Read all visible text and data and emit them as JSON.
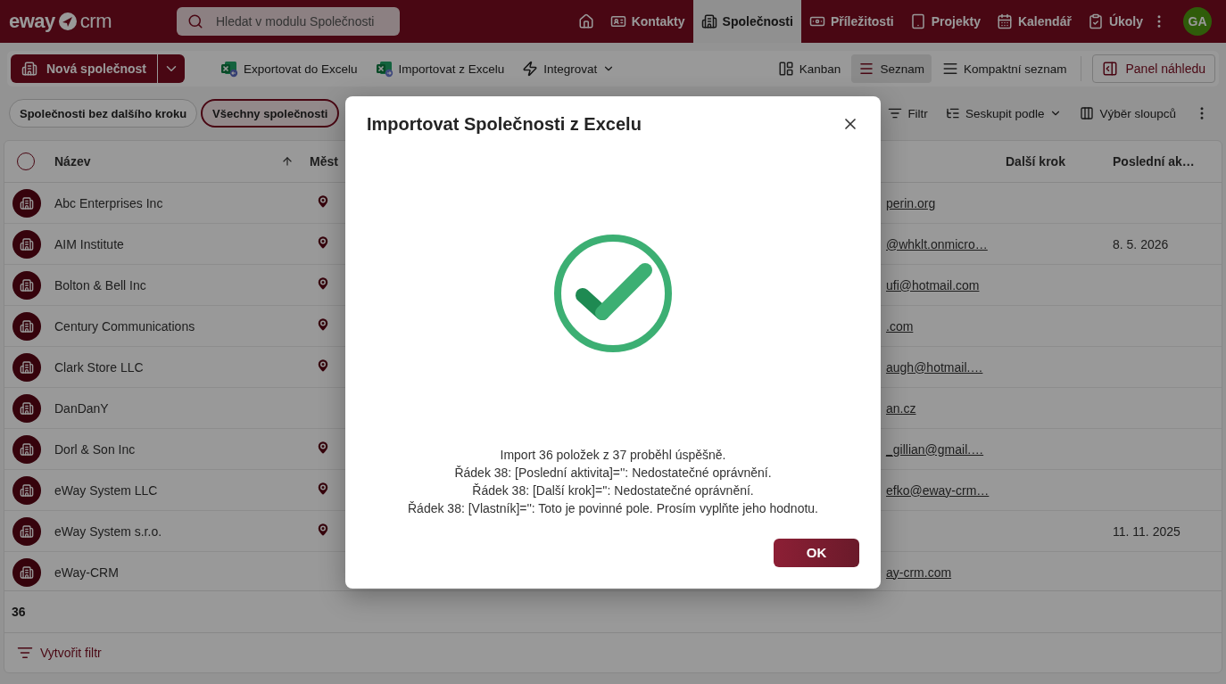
{
  "app": {
    "logo_left": "eway",
    "logo_right": "crm"
  },
  "search": {
    "placeholder": "Hledat v modulu Společnosti"
  },
  "nav": [
    {
      "kind": "home",
      "selected": false
    },
    {
      "kind": "contacts",
      "label": "Kontakty",
      "selected": false
    },
    {
      "kind": "companies",
      "label": "Společnosti",
      "selected": true
    },
    {
      "kind": "deals",
      "label": "Příležitosti",
      "selected": false
    },
    {
      "kind": "projects",
      "label": "Projekty",
      "selected": false
    },
    {
      "kind": "calendar",
      "label": "Kalendář",
      "selected": false
    },
    {
      "kind": "tasks",
      "label": "Úkoly",
      "selected": false
    }
  ],
  "avatar": {
    "initials": "GA"
  },
  "toolbar": {
    "new_button": "Nová společnost",
    "actions": [
      {
        "kind": "export",
        "label": "Exportovat do Excelu"
      },
      {
        "kind": "import",
        "label": "Importovat z Excelu"
      },
      {
        "kind": "integrate",
        "label": "Integrovat"
      }
    ],
    "views": [
      {
        "kind": "kanban",
        "label": "Kanban",
        "selected": false
      },
      {
        "kind": "list",
        "label": "Seznam",
        "selected": true
      },
      {
        "kind": "compact",
        "label": "Kompaktní seznam",
        "selected": false
      }
    ],
    "preview_button": "Panel náhledu"
  },
  "filters": [
    {
      "label": "Společnosti bez dalšího kroku",
      "selected": false
    },
    {
      "label": "Všechny společnosti",
      "selected": true
    }
  ],
  "filter_actions": [
    {
      "kind": "filter",
      "label": "Filtr"
    },
    {
      "kind": "group",
      "label": "Seskupit podle"
    },
    {
      "kind": "columns",
      "label": "Výběr sloupců"
    }
  ],
  "table": {
    "select_all": {
      "checked": false
    },
    "columns": [
      {
        "label": "Název",
        "sorted": true
      },
      {
        "label": "Měst",
        "sorted": false
      },
      {
        "label": "Další krok",
        "sorted": false
      },
      {
        "label": "Poslední ak…",
        "sorted": false
      }
    ],
    "rows": [
      {
        "name": "Abc Enterprises Inc",
        "city_pin": true,
        "email": "perin.org"
      },
      {
        "name": "AIM Institute",
        "city_pin": true,
        "email": "@whklt.onmicro…",
        "last_activity": "8. 5. 2026"
      },
      {
        "name": "Bolton & Bell Inc",
        "city_pin": true,
        "email": "ufi@hotmail.com"
      },
      {
        "name": "Century Communications",
        "city_pin": true,
        "email": ".com"
      },
      {
        "name": "Clark Store LLC",
        "city_pin": true,
        "email": "augh@hotmail.…"
      },
      {
        "name": "DanDanY",
        "city_pin": false,
        "email": "an.cz"
      },
      {
        "name": "Dorl & Son Inc",
        "city_pin": true,
        "email": "_gillian@gmail.…"
      },
      {
        "name": "eWay System LLC",
        "city_pin": true,
        "email": "efko@eway-crm…"
      },
      {
        "name": "eWay System s.r.o.",
        "city_pin": true,
        "last_activity": "11. 11. 2025"
      },
      {
        "name": "eWay-CRM",
        "city_pin": false,
        "email": "ay-crm.com"
      }
    ]
  },
  "footer": {
    "count": "36",
    "create_filter": "Vytvořit filtr"
  },
  "dialog": {
    "title": "Importovat Společnosti z Excelu",
    "messages": [
      "Import 36 položek z 37 proběhl úspěšně.",
      "Řádek 38: [Poslední aktivita]='': Nedostatečné oprávnění.",
      "Řádek 38: [Další krok]='': Nedostatečné oprávnění.",
      "Řádek 38: [Vlastník]='': Toto je povinné pole. Prosím vyplňte jeho hodnotu."
    ],
    "ok": "OK"
  }
}
